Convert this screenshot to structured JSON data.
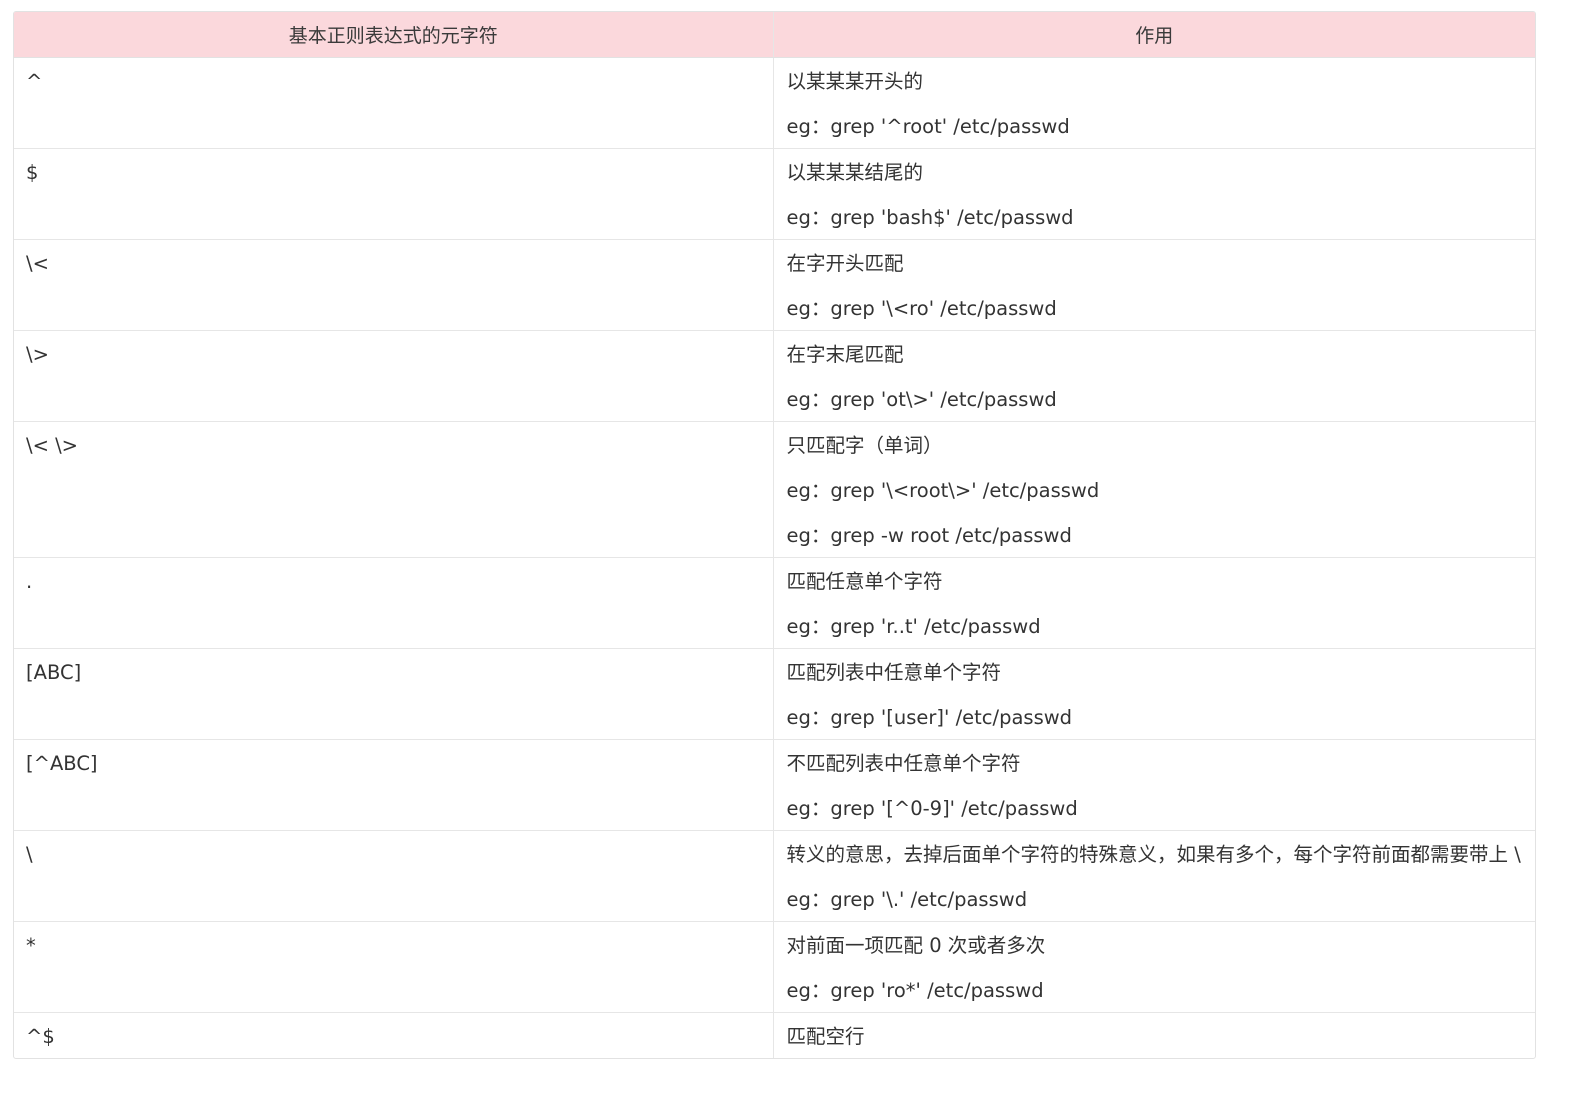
{
  "table": {
    "headers": [
      "基本正则表达式的元字符",
      "作用"
    ],
    "rows": [
      {
        "meta": "^",
        "lines": [
          "以某某某开头的",
          "eg：grep '^root' /etc/passwd"
        ]
      },
      {
        "meta": "$",
        "lines": [
          "以某某某结尾的",
          "eg：grep 'bash$' /etc/passwd"
        ]
      },
      {
        "meta": "\\<",
        "lines": [
          "在字开头匹配",
          "eg：grep '\\<ro' /etc/passwd"
        ]
      },
      {
        "meta": "\\>",
        "lines": [
          "在字末尾匹配",
          "eg：grep 'ot\\>' /etc/passwd"
        ]
      },
      {
        "meta": "\\< \\>",
        "lines": [
          "只匹配字（单词）",
          "eg：grep '\\<root\\>' /etc/passwd",
          "eg：grep -w root /etc/passwd"
        ]
      },
      {
        "meta": ".",
        "lines": [
          "匹配任意单个字符",
          "eg：grep 'r..t' /etc/passwd"
        ]
      },
      {
        "meta": "[ABC]",
        "lines": [
          "匹配列表中任意单个字符",
          "eg：grep '[user]' /etc/passwd"
        ]
      },
      {
        "meta": "[^ABC]",
        "lines": [
          "不匹配列表中任意单个字符",
          "eg：grep '[^0-9]' /etc/passwd"
        ]
      },
      {
        "meta": "\\",
        "lines": [
          "转义的意思，去掉后面单个字符的特殊意义，如果有多个，每个字符前面都需要带上 \\",
          "eg：grep '\\.' /etc/passwd"
        ]
      },
      {
        "meta": "*",
        "lines": [
          "对前面一项匹配 0 次或者多次",
          "eg：grep 'ro*' /etc/passwd"
        ]
      },
      {
        "meta": "^$",
        "lines": [
          "匹配空行"
        ]
      }
    ]
  }
}
